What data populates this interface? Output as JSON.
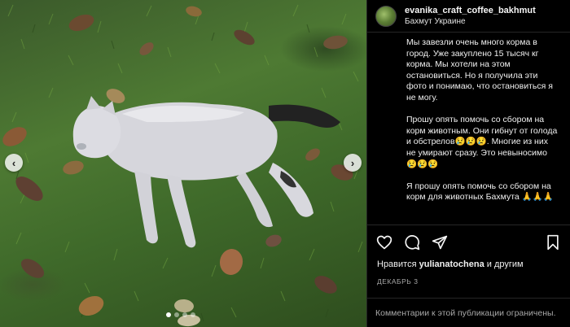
{
  "post": {
    "username": "evanika_craft_coffee_bakhmut",
    "location": "Бахмут Украине",
    "caption": [
      "Мы завезли очень много корма в город. Уже закуплено 15 тысяч кг корма. Мы хотели на этом остановиться. Но я получила эти фото и понимаю, что остановиться я не могу.",
      "Прошу опять помочь со сбором на корм животным. Они гибнут от голода и обстрелов😢😢😢. Многие из них не умирают сразу. Это невыносимо 😢😢😢",
      "Я прошу опять помочь со сбором на корм для животных Бахмута 🙏🙏🙏"
    ],
    "likes_prefix": "Нравится ",
    "likes_user": "yulianatochena",
    "likes_suffix": " и другим",
    "date": "ДЕКАБРЬ 3",
    "comments_disabled": "Комментарии к этой публикации ограничены."
  },
  "icons": {
    "like": "heart-icon",
    "comment": "comment-icon",
    "share": "share-icon",
    "save": "bookmark-icon",
    "prev": "chevron-left-icon",
    "next": "chevron-right-icon"
  },
  "carousel": {
    "count": 4,
    "active_index": 0
  },
  "colors": {
    "background": "#000000",
    "text": "#f5f5f5",
    "muted": "#a8a8a8",
    "divider": "#262626"
  }
}
